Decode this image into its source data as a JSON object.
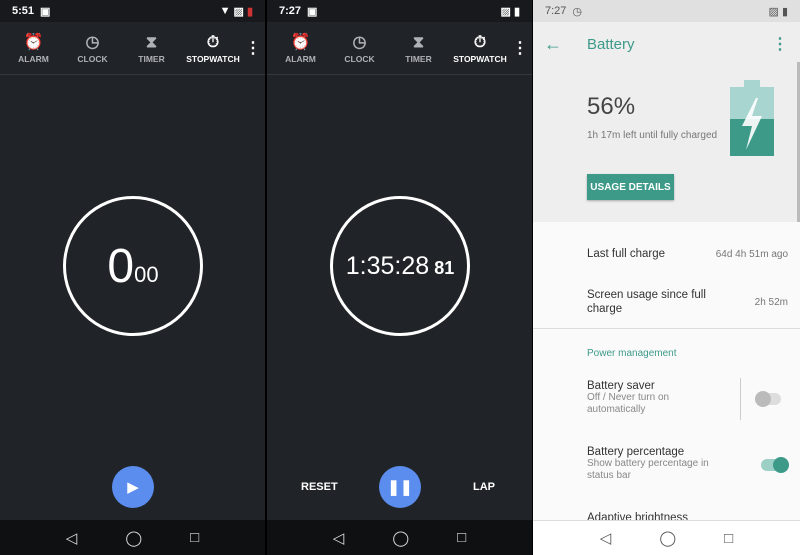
{
  "left": {
    "time": "5:51",
    "tabs": [
      "ALARM",
      "CLOCK",
      "TIMER",
      "STOPWATCH"
    ],
    "seconds": "0",
    "hundredths": "00"
  },
  "middle": {
    "time": "7:27",
    "tabs": [
      "ALARM",
      "CLOCK",
      "TIMER",
      "STOPWATCH"
    ],
    "elapsed": "1:35:28",
    "hundredths": "81",
    "reset": "RESET",
    "lap": "LAP"
  },
  "right": {
    "time": "7:27",
    "title": "Battery",
    "percent": "56%",
    "charge_text": "1h 17m left until fully charged",
    "charge_level": 0.56,
    "usage_button": "USAGE DETAILS",
    "last_full_charge": {
      "label": "Last full charge",
      "value": "64d 4h 51m ago"
    },
    "screen_usage": {
      "label": "Screen usage since full charge",
      "value": "2h 52m"
    },
    "section": "Power management",
    "battery_saver": {
      "label": "Battery saver",
      "summary": "Off / Never turn on automatically",
      "on": false
    },
    "battery_percentage": {
      "label": "Battery percentage",
      "summary": "Show battery percentage in status bar",
      "on": true
    },
    "adaptive": "Adaptive brightness",
    "accent": "#3d9a89"
  },
  "colors": {
    "fab": "#5b8def",
    "dark_bg": "#202327"
  }
}
